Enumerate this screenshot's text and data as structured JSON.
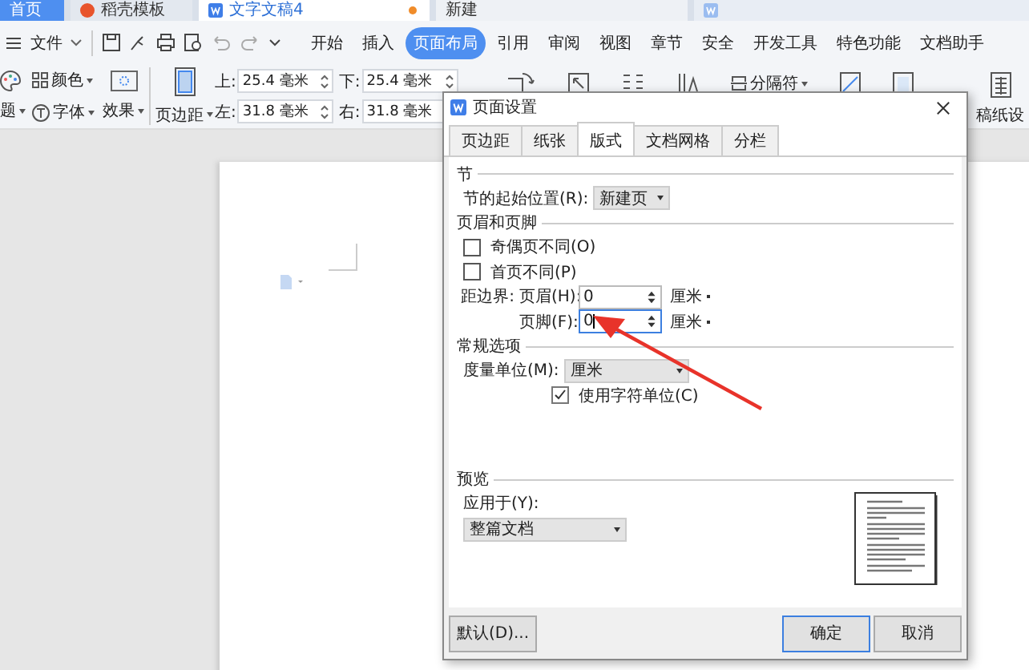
{
  "app_tabs": [
    {
      "label": "首页",
      "kind": "home",
      "selected": false
    },
    {
      "label": "稻壳模板",
      "kind": "docer",
      "selected": false
    },
    {
      "label": "文字文稿4",
      "kind": "doc",
      "selected": true,
      "modified": true
    },
    {
      "label": "新建",
      "kind": "new",
      "selected": false
    },
    {
      "kind": "doc",
      "selected": false
    }
  ],
  "menu": {
    "file": "文件",
    "tabs": [
      {
        "label": "开始",
        "selected": false
      },
      {
        "label": "插入",
        "selected": false
      },
      {
        "label": "页面布局",
        "selected": true
      },
      {
        "label": "引用",
        "selected": false
      },
      {
        "label": "审阅",
        "selected": false
      },
      {
        "label": "视图",
        "selected": false
      },
      {
        "label": "章节",
        "selected": false
      },
      {
        "label": "安全",
        "selected": false
      },
      {
        "label": "开发工具",
        "selected": false
      },
      {
        "label": "特色功能",
        "selected": false
      },
      {
        "label": "文档助手",
        "selected": false
      }
    ]
  },
  "ribbon": {
    "theme": "题",
    "colors_label": "颜色",
    "font": "字体",
    "effect": "效果",
    "margins": "页边距",
    "margin_fields": [
      {
        "label": "上:",
        "value": "25.4 毫米"
      },
      {
        "label": "左:",
        "value": "31.8 毫米"
      },
      {
        "label": "下:",
        "value": "25.4 毫米"
      },
      {
        "label": "右:",
        "value": "31.8 毫米"
      }
    ],
    "separator": "分隔符",
    "draft_paper": "稿纸设"
  },
  "dialog": {
    "title": "页面设置",
    "tabs": [
      {
        "label": "页边距",
        "selected": false
      },
      {
        "label": "纸张",
        "selected": false
      },
      {
        "label": "版式",
        "selected": true
      },
      {
        "label": "文档网格",
        "selected": false
      },
      {
        "label": "分栏",
        "selected": false
      }
    ],
    "section": {
      "heading": "节",
      "start_label": "节的起始位置(R):",
      "start_value": "新建页"
    },
    "header_footer": {
      "heading": "页眉和页脚",
      "checkboxes": [
        {
          "label": "奇偶页不同(O)",
          "checked": false
        },
        {
          "label": "首页不同(P)",
          "checked": false
        }
      ],
      "distance_label": "距边界:",
      "fields": [
        {
          "label": "页眉(H):",
          "value": "0",
          "unit": "厘米",
          "focused": false
        },
        {
          "label": "页脚(F):",
          "value": "0",
          "unit": "厘米",
          "focused": true
        }
      ]
    },
    "general": {
      "heading": "常规选项",
      "unit_label": "度量单位(M):",
      "unit_value": "厘米",
      "char_unit": {
        "label": "使用字符单位(C)",
        "checked": true
      }
    },
    "preview": {
      "heading": "预览",
      "apply_label": "应用于(Y):",
      "apply_value": "整篇文档"
    },
    "buttons": {
      "default": "默认(D)...",
      "ok": "确定",
      "cancel": "取消"
    }
  }
}
